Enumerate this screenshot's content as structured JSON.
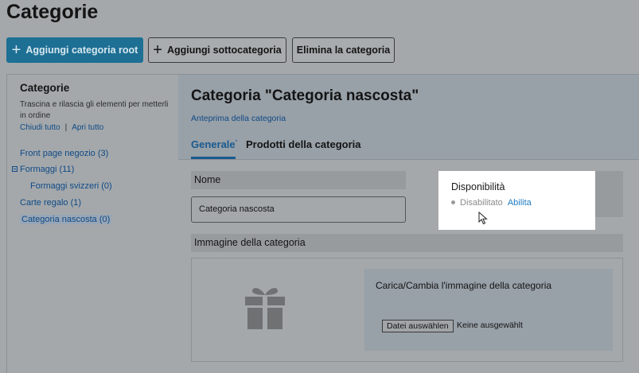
{
  "page": {
    "title": "Categorie"
  },
  "toolbar": {
    "add_root_label": "Aggiungi categoria root",
    "add_sub_label": "Aggiungi sottocategoria",
    "delete_label": "Elimina la categoria"
  },
  "sidebar": {
    "title": "Categorie",
    "help": "Trascina e rilascia gli elementi per metterli in ordine",
    "collapse_all": "Chiudi tutto",
    "separator": "|",
    "expand_all": "Apri tutto",
    "items": [
      {
        "label": "Front page negozio (3)"
      },
      {
        "label": "Formaggi (11)"
      },
      {
        "label": "Formaggi svizzeri (0)"
      },
      {
        "label": "Carte regalo (1)"
      },
      {
        "label": "Categoria nascosta (0)"
      }
    ]
  },
  "main": {
    "title": "Categoria \"Categoria nascosta\"",
    "preview_link": "Anteprima della categoria",
    "tabs": [
      {
        "label": "Generale",
        "marker": "*"
      },
      {
        "label": "Prodotti della categoria"
      }
    ],
    "name_label": "Nome",
    "name_value": "Categoria nascosta",
    "availability": {
      "title": "Disponibilità",
      "status": "Disabilitato",
      "action": "Abilita"
    },
    "image_section": {
      "title": "Immagine della categoria",
      "upload_title": "Carica/Cambia l'immagine della categoria",
      "file_button": "Datei auswählen",
      "file_status": "Keine ausgewählt"
    }
  },
  "colors": {
    "primary": "#1d6f94",
    "link": "#0f4a86",
    "active_tab": "#1a5a8f",
    "enable_link": "#1e7bc4"
  }
}
